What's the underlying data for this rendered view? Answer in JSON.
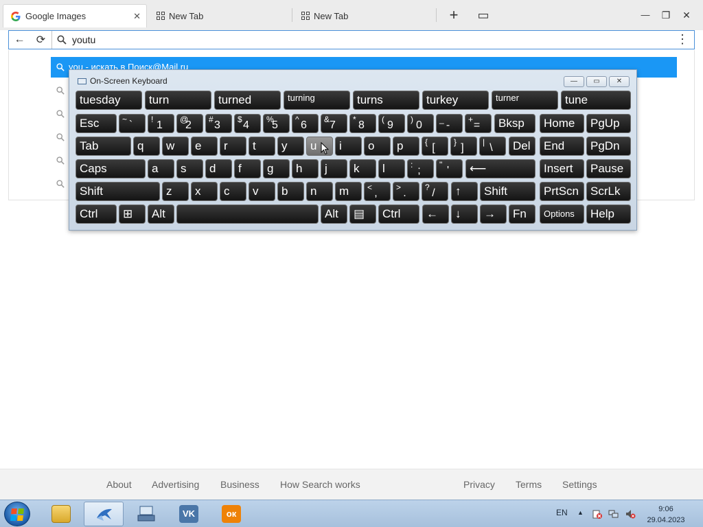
{
  "tabs": [
    {
      "label": "Google Images",
      "close": "✕",
      "icon": "google-g-icon"
    },
    {
      "label": "New Tab",
      "icon": "grid-icon"
    },
    {
      "label": "New Tab",
      "icon": "grid-icon"
    }
  ],
  "browser_controls": {
    "new_tab": "+",
    "tab_list": "▭",
    "minimize": "—",
    "restore": "❐",
    "close": "✕"
  },
  "address_bar": {
    "value": "youtu",
    "back": "←",
    "reload": "⟳",
    "search_icon": "⌕",
    "menu": "⋮"
  },
  "suggestions": {
    "highlighted": "you - искать в Поиск@Mail.ru"
  },
  "osk": {
    "title": "On-Screen Keyboard",
    "win_buttons": [
      "—",
      "▭",
      "✕"
    ],
    "prediction_row": [
      "tuesday",
      "turn",
      "turned",
      "turning",
      "turns",
      "turkey",
      "turner",
      "tune"
    ],
    "row1_labels": {
      "esc": "Esc",
      "bksp": "Bksp",
      "home": "Home",
      "pgup": "PgUp"
    },
    "row1_keys": [
      {
        "shift": "~",
        "main": "`"
      },
      {
        "shift": "!",
        "main": "1"
      },
      {
        "shift": "@",
        "main": "2"
      },
      {
        "shift": "#",
        "main": "3"
      },
      {
        "shift": "$",
        "main": "4"
      },
      {
        "shift": "%",
        "main": "5"
      },
      {
        "shift": "^",
        "main": "6"
      },
      {
        "shift": "&",
        "main": "7"
      },
      {
        "shift": "*",
        "main": "8"
      },
      {
        "shift": "(",
        "main": "9"
      },
      {
        "shift": ")",
        "main": "0"
      },
      {
        "shift": "_",
        "main": "-"
      },
      {
        "shift": "+",
        "main": "="
      }
    ],
    "row2_labels": {
      "tab": "Tab",
      "del": "Del",
      "end": "End",
      "pgdn": "PgDn"
    },
    "row2_letters": [
      "q",
      "w",
      "e",
      "r",
      "t",
      "y",
      "u",
      "i",
      "o",
      "p"
    ],
    "row2_sym": [
      {
        "shift": "{",
        "main": "["
      },
      {
        "shift": "}",
        "main": "]"
      },
      {
        "shift": "|",
        "main": "\\"
      }
    ],
    "row3_labels": {
      "caps": "Caps",
      "enter": "⟵",
      "insert": "Insert",
      "pause": "Pause"
    },
    "row3_letters": [
      "a",
      "s",
      "d",
      "f",
      "g",
      "h",
      "j",
      "k",
      "l"
    ],
    "row3_sym": [
      {
        "shift": ":",
        "main": ";"
      },
      {
        "shift": "\"",
        "main": "'"
      }
    ],
    "row4_labels": {
      "shift_left": "Shift",
      "shift_right": "Shift",
      "up": "↑",
      "prtscn": "PrtScn",
      "scrlk": "ScrLk"
    },
    "row4_letters": [
      "z",
      "x",
      "c",
      "v",
      "b",
      "n",
      "m"
    ],
    "row4_sym": [
      {
        "shift": "<",
        "main": ","
      },
      {
        "shift": ">",
        "main": "."
      },
      {
        "shift": "?",
        "main": "/"
      }
    ],
    "row5_labels": {
      "ctrl_left": "Ctrl",
      "win": "⊞",
      "alt_left": "Alt",
      "alt_right": "Alt",
      "menu": "▤",
      "ctrl_right": "Ctrl",
      "left": "←",
      "down": "↓",
      "right": "→",
      "fn": "Fn",
      "options": "Options",
      "help": "Help"
    }
  },
  "footer": {
    "left_links": [
      "About",
      "Advertising",
      "Business",
      "How Search works"
    ],
    "right_links": [
      "Privacy",
      "Terms",
      "Settings"
    ]
  },
  "taskbar": {
    "apps": [
      "file-explorer-icon",
      "on-screen-keyboard-app-icon",
      "computer-keyboard-icon",
      "vk-icon",
      "odnoklassniki-icon"
    ],
    "vk_label": "VK",
    "ok_label": "ок",
    "lang": "EN",
    "tray_arrow": "▲",
    "time": "9:06",
    "date": "29.04.2023"
  },
  "colors": {
    "suggest_highlight": "#1a97f5",
    "key_bg": "#1e1e1e",
    "key_hover": "#8a8a8a",
    "taskbar": "#b3cbe4"
  }
}
